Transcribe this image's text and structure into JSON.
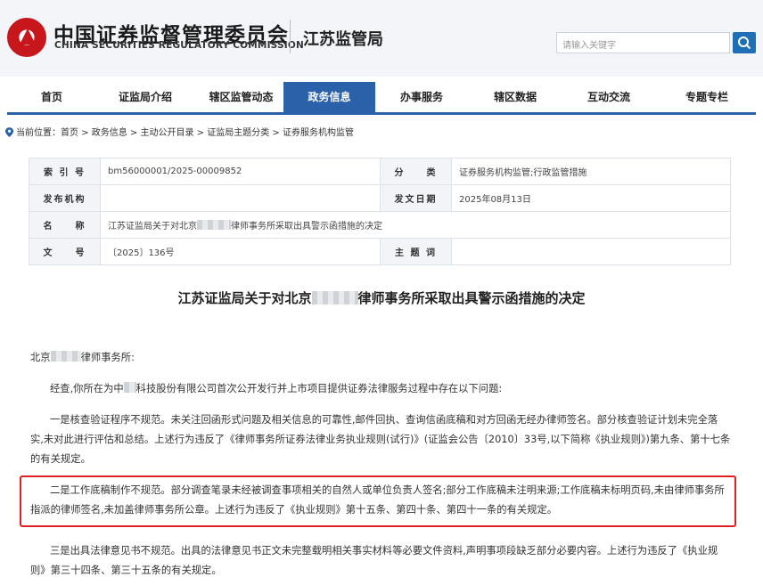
{
  "header": {
    "org_cn": "中国证券监督管理委员会",
    "org_en": "CHINA SECURITIES REGULATORY COMMISSION",
    "bureau": "江苏监管局",
    "search_placeholder": "请输入关键字"
  },
  "nav": {
    "items": [
      "首页",
      "证监局介绍",
      "辖区监管动态",
      "政务信息",
      "办事服务",
      "辖区数据",
      "互动交流",
      "专题专栏"
    ],
    "active": "政务信息"
  },
  "breadcrumb": "当前位置：首页 > 政务信息 > 主动公开目录 > 证监局主题分类 > 证券服务机构监管",
  "meta": {
    "index_label": "索 引 号",
    "index_value": "bm56000001/2025-00009852",
    "category_label": "分　　类",
    "category_value": "证券服务机构监管;行政监管措施",
    "issuer_label": "发布机构",
    "issuer_value": "",
    "date_label": "发文日期",
    "date_value": "2025年08月13日",
    "name_label": "名　　称",
    "name_value_prefix": "江苏证监局关于对北京",
    "name_value_suffix": "律师事务所采取出具警示函措施的决定",
    "docno_label": "文　　号",
    "docno_value": "〔2025〕136号",
    "subject_label": "主 题 词",
    "subject_value": ""
  },
  "document": {
    "title_prefix": "江苏证监局关于对北京",
    "title_suffix": "律师事务所采取出具警示函措施的决定",
    "addressee_prefix": "北京",
    "addressee_suffix": "律师事务所:",
    "p1_prefix": "经查,你所在为中",
    "p1_suffix": "科技股份有限公司首次公开发行并上市项目提供证券法律服务过程中存在以下问题:",
    "p2": "一是核查验证程序不规范。未关注回函形式问题及相关信息的可靠性,邮件回执、查询信函底稿和对方回函无经办律师签名。部分核查验证计划未完全落实,未对此进行评估和总结。上述行为违反了《律师事务所证券法律业务执业规则(试行)》(证监会公告〔2010〕33号,以下简称《执业规则》)第九条、第十七条的有关规定。",
    "p3": "二是工作底稿制作不规范。部分调查笔录未经被调查事项相关的自然人或单位负责人签名;部分工作底稿未注明来源;工作底稿未标明页码,未由律师事务所指派的律师签名,未加盖律师事务所公章。上述行为违反了《执业规则》第十五条、第四十条、第四十一条的有关规定。",
    "p4": "三是出具法律意见书不规范。出具的法律意见书正文未完整载明相关事实材料等必要文件资料,声明事项段缺乏部分必要内容。上述行为违反了《执业规则》第三十四条、第三十五条的有关规定。"
  },
  "colors": {
    "nav_active": "#2a61a8",
    "highlight_border": "#e02020",
    "search_button": "#1f6fb5"
  }
}
